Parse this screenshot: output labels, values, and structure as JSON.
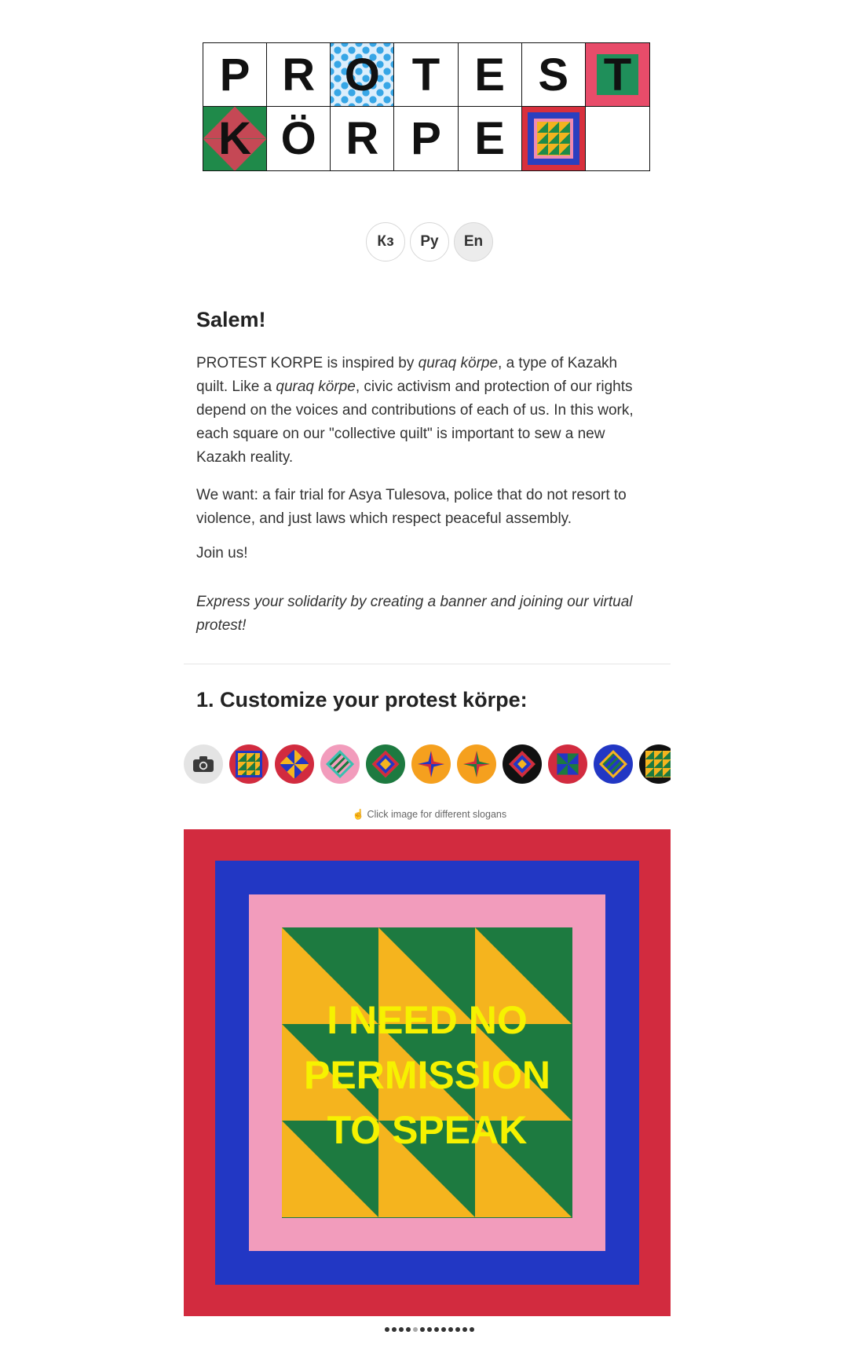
{
  "logo": {
    "row1": [
      "P",
      "R",
      "O",
      "T",
      "E",
      "S",
      "T"
    ],
    "row2": [
      "K",
      "Ö",
      "R",
      "P",
      "E",
      "",
      ""
    ]
  },
  "languages": [
    {
      "label": "Кз",
      "active": false
    },
    {
      "label": "Ру",
      "active": false
    },
    {
      "label": "En",
      "active": true
    }
  ],
  "intro": {
    "greeting": "Salem!",
    "p1_a": "PROTEST KORPE is inspired by ",
    "p1_b": "quraq körpe",
    "p1_c": ", a type of Kazakh quilt. Like a ",
    "p1_d": "quraq körpe",
    "p1_e": ", civic activism and protection of our rights depend on the voices and contributions of each of us. In this work, each square on our \"collective quilt\" is important to sew a new Kazakh reality.",
    "p2": "We want: a fair trial for Asya Tulesova, police that do not resort to violence, and just laws which respect peaceful assembly.",
    "p3": "Join us!",
    "p4": "Express your solidarity by creating a banner and joining our virtual protest!"
  },
  "step1": {
    "title": "1. Customize your protest körpe:",
    "hint": "Click image for different slogans"
  },
  "swatches": [
    {
      "icon": "camera-icon",
      "colors": [
        "#e4e4e4"
      ]
    },
    {
      "icon": "quilt-triangles-icon",
      "colors": [
        "#d22b3f",
        "#2237c4",
        "#f5b41e",
        "#1d7a40"
      ]
    },
    {
      "icon": "quilt-star-icon",
      "colors": [
        "#d22b3f",
        "#2237c4",
        "#f5b41e"
      ]
    },
    {
      "icon": "quilt-knot-icon",
      "colors": [
        "#f29cbc",
        "#1d7a40",
        "#39c0b0"
      ]
    },
    {
      "icon": "quilt-diamond-icon",
      "colors": [
        "#1d7a40",
        "#f5b41e",
        "#d22b3f",
        "#2237c4"
      ]
    },
    {
      "icon": "quilt-pinwheel-icon",
      "colors": [
        "#f5a01e",
        "#d22b3f",
        "#2237c4"
      ]
    },
    {
      "icon": "quilt-pinwheel-icon",
      "colors": [
        "#f5a01e",
        "#1d7a40",
        "#d22b3f"
      ]
    },
    {
      "icon": "quilt-cross-icon",
      "colors": [
        "#111111",
        "#f5b41e",
        "#d22b3f",
        "#2237c4"
      ]
    },
    {
      "icon": "quilt-star-icon",
      "colors": [
        "#d22b3f",
        "#1d7a40",
        "#2237c4"
      ]
    },
    {
      "icon": "quilt-knot-icon",
      "colors": [
        "#2237c4",
        "#1d7a40",
        "#f5b41e"
      ]
    },
    {
      "icon": "quilt-triangles-icon",
      "colors": [
        "#111111",
        "#1d7a40",
        "#f5b41e"
      ]
    }
  ],
  "banner": {
    "slogan": "I NEED NO\nPERMISSION\nTO SPEAK",
    "colors": {
      "outer": "#d22b3f",
      "blue": "#2237c4",
      "pink": "#f29cbc",
      "green": "#1d7a40",
      "yellow": "#f5b41e",
      "text": "#f6f200"
    }
  },
  "pagination": {
    "total": 13,
    "active_index": 4
  }
}
